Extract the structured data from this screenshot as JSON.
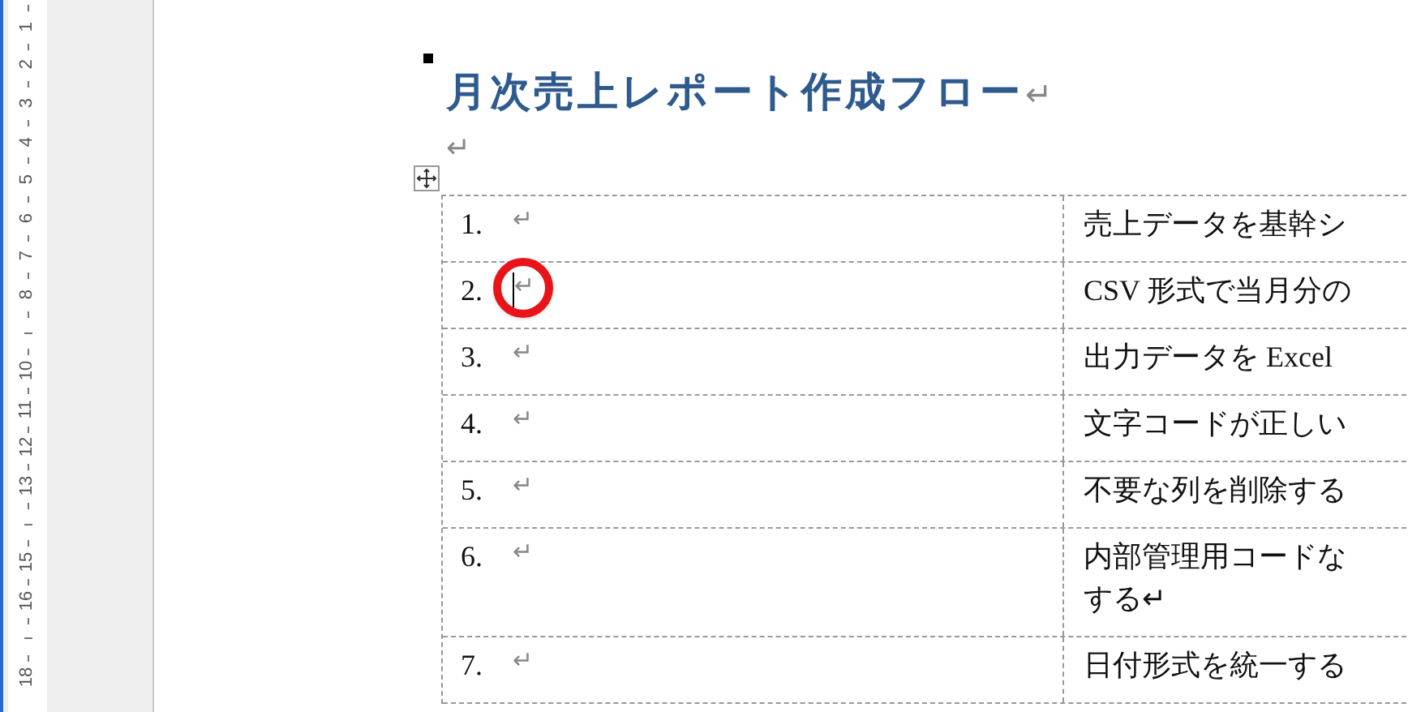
{
  "ruler": [
    {
      "kind": "number",
      "label": "1"
    },
    {
      "kind": "number",
      "label": "2"
    },
    {
      "kind": "number",
      "label": "3"
    },
    {
      "kind": "number",
      "label": "4"
    },
    {
      "kind": "number",
      "label": "5"
    },
    {
      "kind": "number",
      "label": "6"
    },
    {
      "kind": "number",
      "label": "7"
    },
    {
      "kind": "number",
      "label": "8"
    },
    {
      "kind": "blank"
    },
    {
      "kind": "number",
      "label": "10"
    },
    {
      "kind": "number",
      "label": "11"
    },
    {
      "kind": "number",
      "label": "12"
    },
    {
      "kind": "number",
      "label": "13"
    },
    {
      "kind": "blank"
    },
    {
      "kind": "number",
      "label": "15"
    },
    {
      "kind": "number",
      "label": "16"
    },
    {
      "kind": "blank"
    },
    {
      "kind": "number",
      "label": "18"
    }
  ],
  "document": {
    "title": "月次売上レポート作成フロー",
    "paragraph_mark": "↵",
    "table": {
      "rows": [
        {
          "number": "1.",
          "mark": "↵",
          "cursor": false,
          "annotated": false,
          "lines": [
            "売上データを基幹シ"
          ]
        },
        {
          "number": "2.",
          "mark": "↵",
          "cursor": true,
          "annotated": true,
          "lines": [
            "CSV 形式で当月分の"
          ]
        },
        {
          "number": "3.",
          "mark": "↵",
          "cursor": false,
          "annotated": false,
          "lines": [
            "出力データを Excel"
          ]
        },
        {
          "number": "4.",
          "mark": "↵",
          "cursor": false,
          "annotated": false,
          "lines": [
            "文字コードが正しい"
          ]
        },
        {
          "number": "5.",
          "mark": "↵",
          "cursor": false,
          "annotated": false,
          "lines": [
            "不要な列を削除する"
          ]
        },
        {
          "number": "6.",
          "mark": "↵",
          "cursor": false,
          "annotated": false,
          "lines": [
            "内部管理用コードな",
            "する↵"
          ]
        },
        {
          "number": "7.",
          "mark": "↵",
          "cursor": false,
          "annotated": false,
          "lines": [
            "日付形式を統一する"
          ]
        }
      ]
    }
  }
}
